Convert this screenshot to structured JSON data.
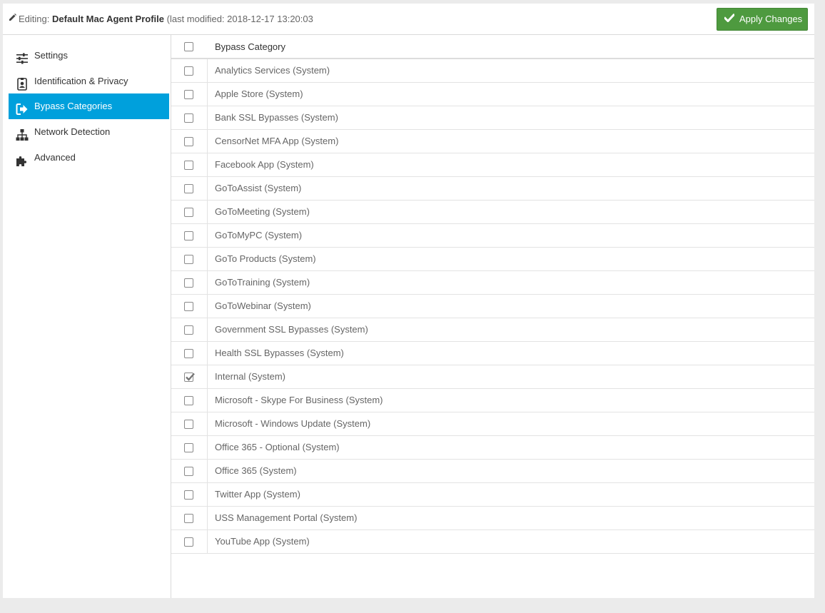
{
  "header": {
    "editing_label": "Editing:",
    "profile_name": "Default Mac Agent Profile",
    "modified_text": "(last modified: 2018-12-17 13:20:03",
    "apply_label": "Apply Changes"
  },
  "sidebar": {
    "items": [
      {
        "label": "Settings",
        "icon": "sliders-icon",
        "active": false
      },
      {
        "label": "Identification & Privacy",
        "icon": "id-badge-icon",
        "active": false
      },
      {
        "label": "Bypass Categories",
        "icon": "sign-out-icon",
        "active": true
      },
      {
        "label": "Network Detection",
        "icon": "sitemap-icon",
        "active": false
      },
      {
        "label": "Advanced",
        "icon": "puzzle-icon",
        "active": false
      }
    ]
  },
  "table": {
    "header": "Bypass Category",
    "rows": [
      {
        "label": "Analytics Services (System)",
        "checked": false
      },
      {
        "label": "Apple Store (System)",
        "checked": false
      },
      {
        "label": "Bank SSL Bypasses (System)",
        "checked": false
      },
      {
        "label": "CensorNet MFA App (System)",
        "checked": false
      },
      {
        "label": "Facebook App (System)",
        "checked": false
      },
      {
        "label": "GoToAssist (System)",
        "checked": false
      },
      {
        "label": "GoToMeeting (System)",
        "checked": false
      },
      {
        "label": "GoToMyPC (System)",
        "checked": false
      },
      {
        "label": "GoTo Products (System)",
        "checked": false
      },
      {
        "label": "GoToTraining (System)",
        "checked": false
      },
      {
        "label": "GoToWebinar (System)",
        "checked": false
      },
      {
        "label": "Government SSL Bypasses (System)",
        "checked": false
      },
      {
        "label": "Health SSL Bypasses (System)",
        "checked": false
      },
      {
        "label": "Internal (System)",
        "checked": true
      },
      {
        "label": "Microsoft - Skype For Business (System)",
        "checked": false
      },
      {
        "label": "Microsoft - Windows Update (System)",
        "checked": false
      },
      {
        "label": "Office 365 - Optional (System)",
        "checked": false
      },
      {
        "label": "Office 365 (System)",
        "checked": false
      },
      {
        "label": "Twitter App (System)",
        "checked": false
      },
      {
        "label": "USS Management Portal (System)",
        "checked": false
      },
      {
        "label": "YouTube App (System)",
        "checked": false
      }
    ]
  },
  "colors": {
    "accent": "#00a0dc",
    "apply_button": "#4e9a3f"
  }
}
